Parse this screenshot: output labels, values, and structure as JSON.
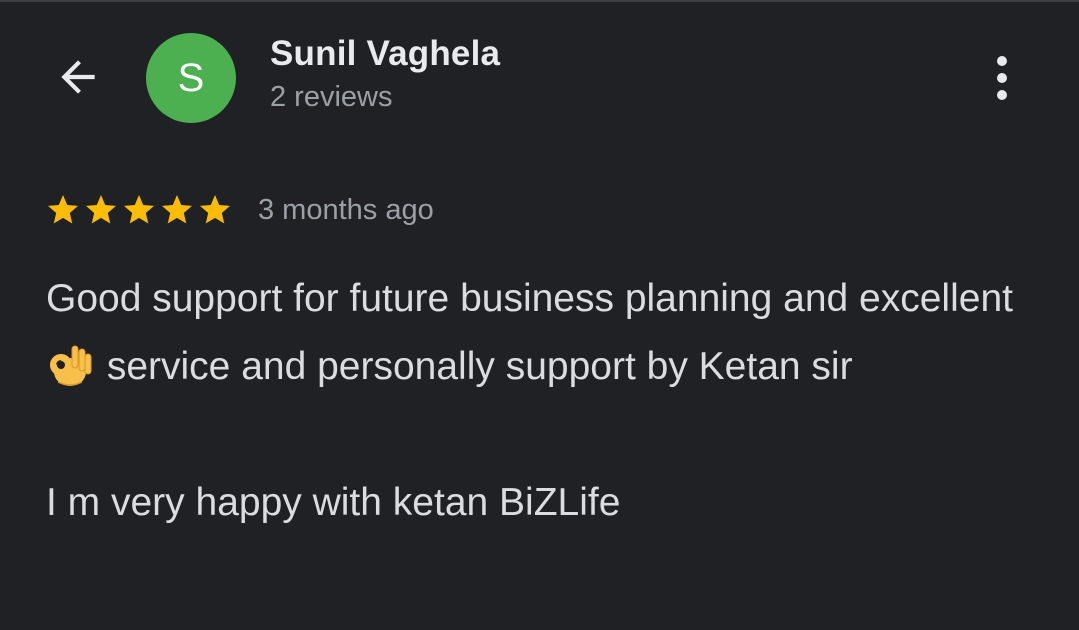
{
  "header": {
    "back_icon": "arrow-left-icon",
    "avatar_letter": "S",
    "avatar_color": "#4caf50",
    "reviewer_name": "Sunil Vaghela",
    "reviews_count": "2 reviews",
    "more_icon": "more-vertical-icon"
  },
  "review": {
    "rating": 5,
    "max_rating": 5,
    "star_color": "#fbbc04",
    "date": "3 months ago",
    "paragraph1_part1": "Good support for future business planning and excellent",
    "emoji_icon": "ok-hand-emoji-icon",
    "paragraph1_part2": "service and personally support by Ketan sir",
    "paragraph2": "I m very happy with ketan BiZLife"
  }
}
